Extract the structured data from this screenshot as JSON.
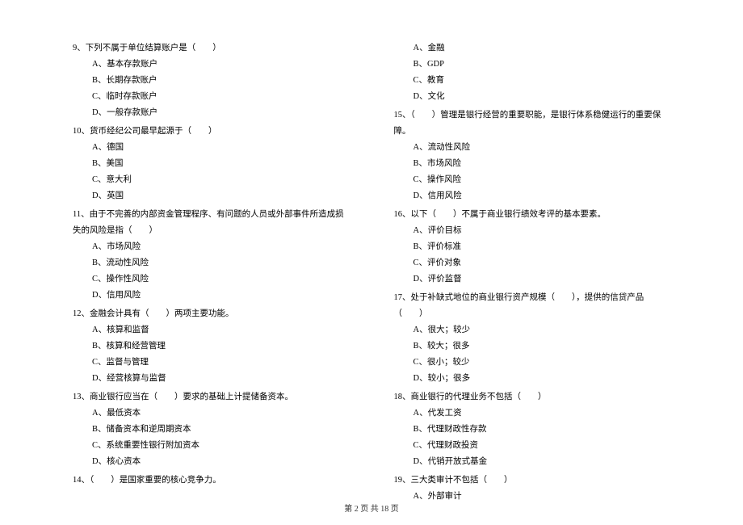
{
  "left": {
    "q9": {
      "stem": "9、下列不属于单位结算账户是（　　）",
      "A": "A、基本存款账户",
      "B": "B、长期存款账户",
      "C": "C、临时存款账户",
      "D": "D、一般存款账户"
    },
    "q10": {
      "stem": "10、货币经纪公司最早起源于（　　）",
      "A": "A、德国",
      "B": "B、美国",
      "C": "C、意大利",
      "D": "D、英国"
    },
    "q11": {
      "stem": "11、由于不完善的内部资金管理程序、有问题的人员或外部事件所造成损失的风险是指（　　）",
      "A": "A、市场风险",
      "B": "B、流动性风险",
      "C": "C、操作性风险",
      "D": "D、信用风险"
    },
    "q12": {
      "stem": "12、金融会计具有（　　）两项主要功能。",
      "A": "A、核算和监督",
      "B": "B、核算和经营管理",
      "C": "C、监督与管理",
      "D": "D、经营核算与监督"
    },
    "q13": {
      "stem": "13、商业银行应当在（　　）要求的基础上计提储备资本。",
      "A": "A、最低资本",
      "B": "B、储备资本和逆周期资本",
      "C": "C、系统重要性银行附加资本",
      "D": "D、核心资本"
    },
    "q14": {
      "stem": "14、（　　）是国家重要的核心竞争力。"
    }
  },
  "right": {
    "q14opts": {
      "A": "A、金融",
      "B": "B、GDP",
      "C": "C、教育",
      "D": "D、文化"
    },
    "q15": {
      "stem": "15、（　　）管理是银行经营的重要职能，是银行体系稳健运行的重要保障。",
      "A": "A、流动性风险",
      "B": "B、市场风险",
      "C": "C、操作风险",
      "D": "D、信用风险"
    },
    "q16": {
      "stem": "16、以下（　　）不属于商业银行绩效考评的基本要素。",
      "A": "A、评价目标",
      "B": "B、评价标准",
      "C": "C、评价对象",
      "D": "D、评价监督"
    },
    "q17": {
      "stem": "17、处于补缺式地位的商业银行资产规模（　　），提供的信贷产品（　　）",
      "A": "A、很大；较少",
      "B": "B、较大；很多",
      "C": "C、很小；较少",
      "D": "D、较小；很多"
    },
    "q18": {
      "stem": "18、商业银行的代理业务不包括（　　）",
      "A": "A、代发工资",
      "B": "B、代理财政性存款",
      "C": "C、代理财政投资",
      "D": "D、代销开放式基金"
    },
    "q19": {
      "stem": "19、三大类审计不包括（　　）",
      "A": "A、外部审计"
    }
  },
  "footer": "第 2 页 共 18 页"
}
